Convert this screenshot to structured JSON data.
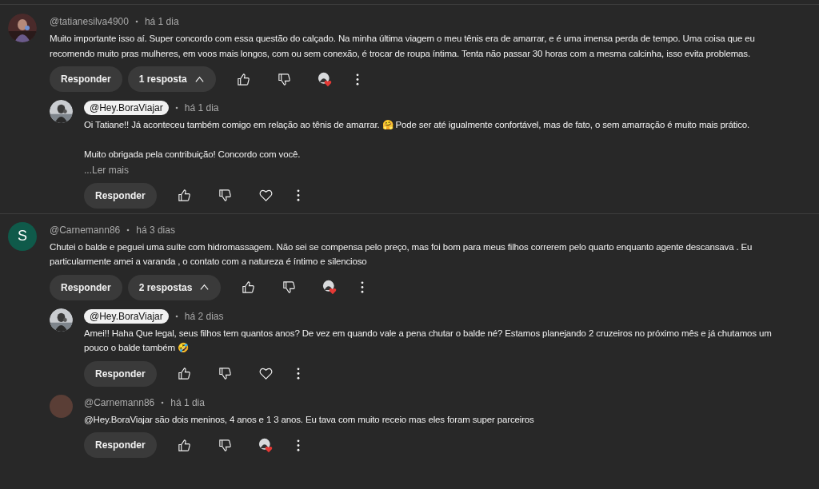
{
  "threads": [
    {
      "comment": {
        "avatar": {
          "kind": "picture"
        },
        "author": "@tatianesilva4900",
        "creator": false,
        "time": "há 1 dia",
        "paragraphs": [
          "Muito importante isso aí. Super concordo com essa questão do calçado. Na minha última viagem o meu tênis era de amarrar, e é uma imensa perda de tempo. Uma coisa que eu recomendo muito pras mulheres, em voos mais longos, com ou sem conexão, é trocar de roupa íntima. Tenta não passar 30 horas com a mesma calcinha, isso evita problemas."
        ],
        "reply_label": "Responder",
        "hearted": true,
        "replies_toggle": {
          "label": "1 resposta",
          "expanded": true
        }
      },
      "replies": [
        {
          "avatar": {
            "kind": "picture"
          },
          "author": "@Hey.BoraViajar",
          "creator": true,
          "time": "há 1 dia",
          "paragraphs": [
            "Oi Tatiane!! Já aconteceu também comigo em relação ao tênis de amarrar. 🤗 Pode ser até igualmente confortável, mas de fato, o sem amarração é muito mais prático.",
            "Muito obrigada pela contribuição! Concordo com você."
          ],
          "read_more": "...Ler mais",
          "reply_label": "Responder",
          "hearted": false
        }
      ]
    },
    {
      "comment": {
        "avatar": {
          "kind": "letter",
          "letter": "S",
          "color": "#0f5a4a"
        },
        "author": "@Carnemann86",
        "creator": false,
        "time": "há 3 dias",
        "paragraphs": [
          "Chutei o balde e peguei uma suíte com hidromassagem. Não sei se compensa pelo preço, mas foi bom para meus filhos correrem pelo quarto enquanto agente descansava . Eu particularmente amei a varanda , o contato com a natureza é íntimo e silencioso"
        ],
        "reply_label": "Responder",
        "hearted": true,
        "replies_toggle": {
          "label": "2 respostas",
          "expanded": true
        }
      },
      "replies": [
        {
          "avatar": {
            "kind": "picture"
          },
          "author": "@Hey.BoraViajar",
          "creator": true,
          "time": "há 2 dias",
          "paragraphs": [
            "Amei!! Haha Que legal, seus filhos tem quantos anos? De vez em quando vale a pena chutar o balde né? Estamos planejando 2 cruzeiros no próximo mês e já chutamos um pouco o balde também 🤣"
          ],
          "reply_label": "Responder",
          "hearted": false
        },
        {
          "avatar": {
            "kind": "plain",
            "color": "#5a3e36"
          },
          "author": "@Carnemann86",
          "creator": false,
          "time": "há 1 dia",
          "paragraphs": [
            "@Hey.BoraViajar  são dois meninos, 4 anos e 1 3 anos. Eu tava com muito receio mas eles foram super parceiros"
          ],
          "reply_label": "Responder",
          "hearted": true
        }
      ]
    }
  ]
}
